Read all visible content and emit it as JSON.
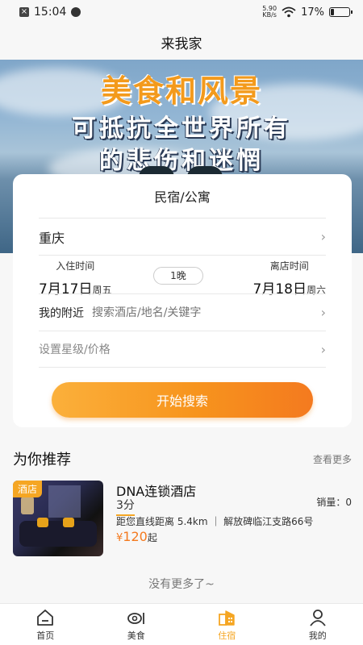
{
  "status_bar": {
    "time": "15:04",
    "net_speed_value": "5.90",
    "net_speed_unit": "KB/s",
    "battery_text": "17%",
    "battery_level": 0.17
  },
  "header": {
    "title": "来我家"
  },
  "banner": {
    "line1": "美食和风景",
    "line2": "可抵抗全世界所有",
    "line3": "的悲伤和迷惘"
  },
  "search_card": {
    "title": "民宿/公寓",
    "city": "重庆",
    "checkin": {
      "label": "入住时间",
      "date": "7月17日",
      "weekday": "周五"
    },
    "nights": "1晚",
    "checkout": {
      "label": "离店时间",
      "date": "7月18日",
      "weekday": "周六"
    },
    "nearby_label": "我的附近",
    "search_placeholder": "搜索酒店/地名/关键字",
    "star_price": "设置星级/价格",
    "chevron": "›"
  },
  "search_button": "开始搜索",
  "recommend": {
    "title": "为你推荐",
    "more": "查看更多",
    "items": [
      {
        "tag": "酒店",
        "name": "DNA连锁酒店",
        "score": "3分",
        "sales": "销量：0",
        "address": "距您直线距离 5.4km ｜ 解放碑临江支路66号",
        "currency": "¥",
        "price": "120",
        "price_suffix": "起"
      }
    ]
  },
  "no_more": "没有更多了~",
  "tabs": [
    {
      "label": "首页",
      "icon": "home-icon",
      "active": false
    },
    {
      "label": "美食",
      "icon": "food-icon",
      "active": false
    },
    {
      "label": "住宿",
      "icon": "hotel-icon",
      "active": true
    },
    {
      "label": "我的",
      "icon": "profile-icon",
      "active": false
    }
  ],
  "colors": {
    "accent": "#f5a623",
    "button_start": "#fbb03b",
    "button_end": "#f47a1f"
  }
}
